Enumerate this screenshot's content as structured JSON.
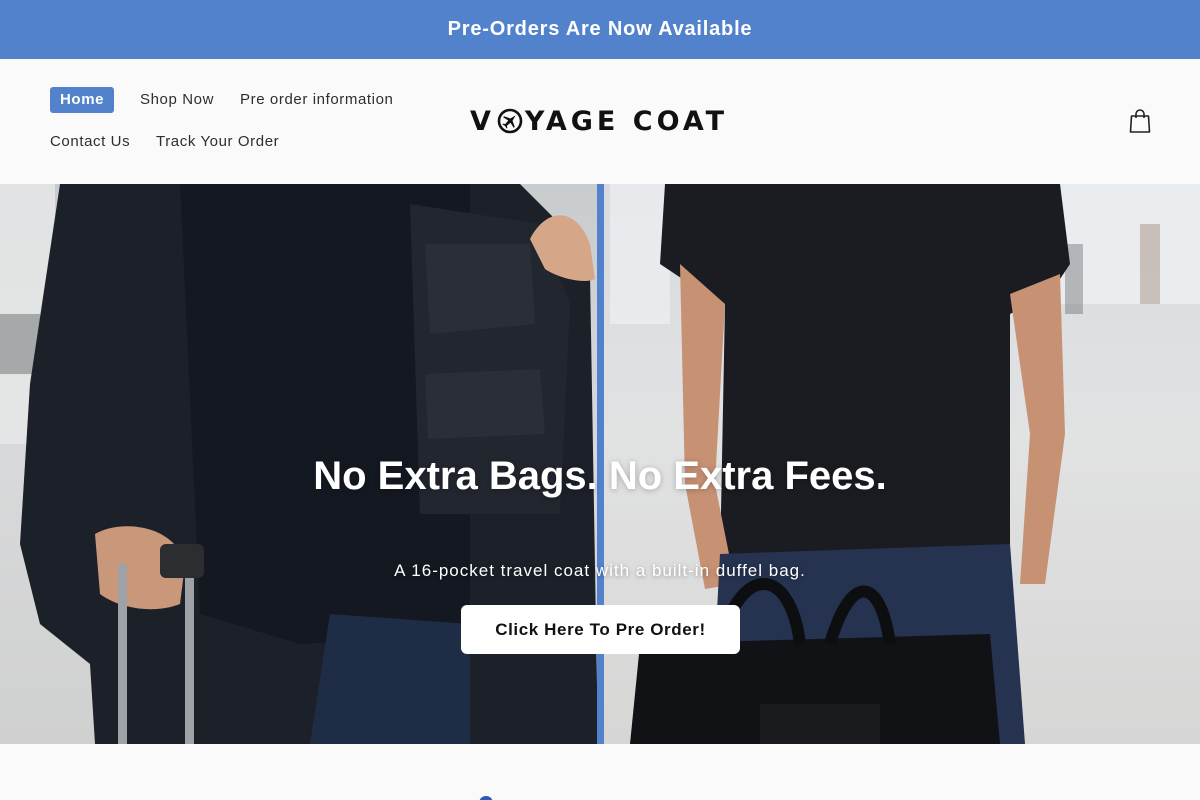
{
  "announcement": {
    "text": "Pre-Orders Are Now Available"
  },
  "nav": {
    "items": [
      {
        "label": "Home",
        "active": true
      },
      {
        "label": "Shop Now"
      },
      {
        "label": "Pre order information"
      },
      {
        "label": "Contact Us"
      },
      {
        "label": "Track Your Order"
      }
    ]
  },
  "logo": {
    "text_left": "V",
    "text_right": "YAGE COAT",
    "icon": "airplane-circle-icon"
  },
  "cart": {
    "icon": "shopping-bag-icon"
  },
  "hero": {
    "title": "No Extra Bags. No Extra Fees.",
    "subtitle": "A 16-pocket travel coat with a built-in duffel bag.",
    "cta_label": "Click Here To Pre Order!"
  },
  "colors": {
    "accent": "#5282cc",
    "header_bg": "#fafafa",
    "text": "#222222"
  }
}
